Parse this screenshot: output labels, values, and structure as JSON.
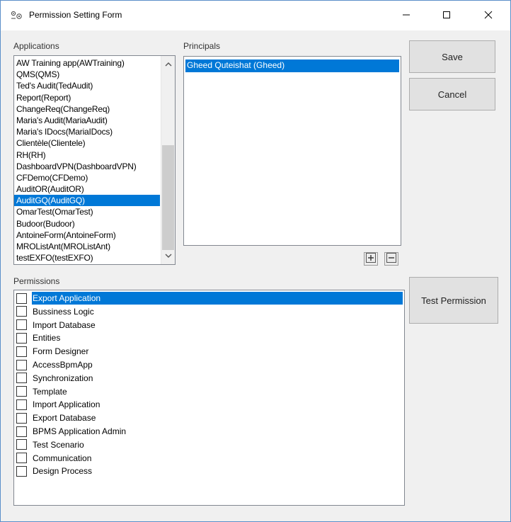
{
  "window": {
    "title": "Permission Setting Form",
    "controls": {
      "minimize": "minimize-icon",
      "maximize": "maximize-icon",
      "close": "close-icon"
    }
  },
  "applications": {
    "label": "Applications",
    "items": [
      "AW Training app(AWTraining)",
      "QMS(QMS)",
      "Ted's Audit(TedAudit)",
      "Report(Report)",
      "ChangeReq(ChangeReq)",
      "Maria's Audit(MariaAudit)",
      "Maria's IDocs(MariaIDocs)",
      "Clientèle(Clientele)",
      "RH(RH)",
      "DashboardVPN(DashboardVPN)",
      "CFDemo(CFDemo)",
      "AuditOR(AuditOR)",
      "AuditGQ(AuditGQ)",
      "OmarTest(OmarTest)",
      "Budoor(Budoor)",
      "AntoineForm(AntoineForm)",
      "MROListAnt(MROListAnt)",
      "testEXFO(testEXFO)"
    ],
    "selected_index": 12
  },
  "principals": {
    "label": "Principals",
    "items": [
      "Gheed Quteishat (Gheed)"
    ],
    "selected_index": 0
  },
  "buttons": {
    "save": "Save",
    "cancel": "Cancel",
    "test_permission": "Test Permission",
    "add_icon": "plus-icon",
    "remove_icon": "minus-icon"
  },
  "permissions": {
    "label": "Permissions",
    "items": [
      {
        "label": "Export Application",
        "checked": false
      },
      {
        "label": "Bussiness Logic",
        "checked": false
      },
      {
        "label": "Import Database",
        "checked": false
      },
      {
        "label": "Entities",
        "checked": false
      },
      {
        "label": "Form Designer",
        "checked": false
      },
      {
        "label": "AccessBpmApp",
        "checked": false
      },
      {
        "label": "Synchronization",
        "checked": false
      },
      {
        "label": "Template",
        "checked": false
      },
      {
        "label": "Import Application",
        "checked": false
      },
      {
        "label": "Export Database",
        "checked": false
      },
      {
        "label": "BPMS Application Admin",
        "checked": false
      },
      {
        "label": "Test Scenario",
        "checked": false
      },
      {
        "label": "Communication",
        "checked": false
      },
      {
        "label": "Design Process",
        "checked": false
      }
    ],
    "selected_index": 0
  },
  "colors": {
    "selection": "#0078d7",
    "window_bg": "#f0f0f0",
    "button_bg": "#e1e1e1"
  }
}
